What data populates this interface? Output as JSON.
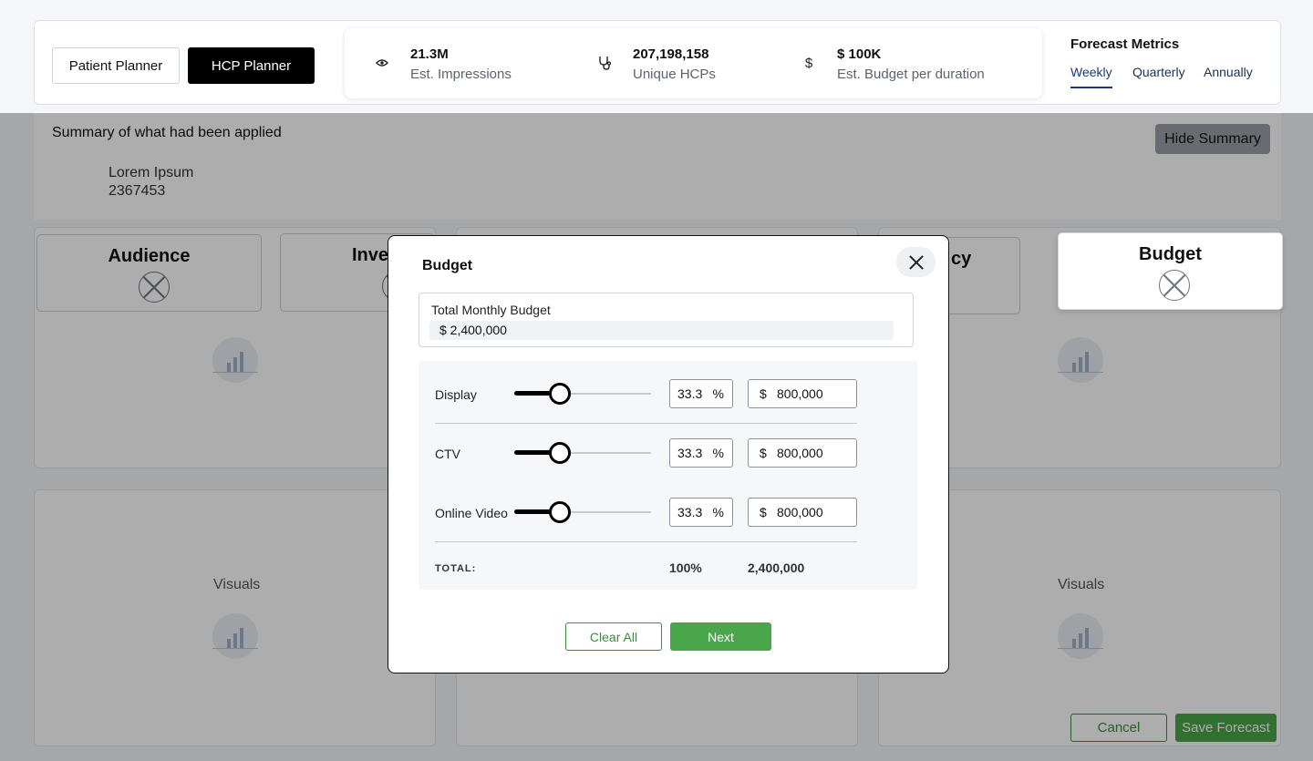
{
  "header": {
    "patient_planner": "Patient Planner",
    "hcp_planner": "HCP Planner",
    "stats": [
      {
        "icon": "eye-icon",
        "value": "21.3M",
        "label": "Est. Impressions"
      },
      {
        "icon": "stethoscope-icon",
        "value": "207,198,158",
        "label": "Unique HCPs"
      },
      {
        "icon": "dollar-icon",
        "value": "$ 100K",
        "label": "Est. Budget per duration"
      }
    ],
    "forecast_title": "Forecast Metrics",
    "tabs": [
      "Weekly",
      "Quarterly",
      "Annually"
    ],
    "active_tab": "Weekly"
  },
  "summary": {
    "title": "Summary of what had been applied",
    "hide_button": "Hide Summary",
    "line1": "Lorem Ipsum",
    "line2": "2367453"
  },
  "cards": {
    "audience": "Audience",
    "inventory_partial": "Inve",
    "frequency_partial": "cy",
    "budget": "Budget"
  },
  "visuals_label": "Visuals",
  "footer": {
    "cancel": "Cancel",
    "save": "Save Forecast"
  },
  "modal": {
    "title": "Budget",
    "total_monthly_label": "Total Monthly Budget",
    "total_monthly_value": "$ 2,400,000",
    "rows": [
      {
        "label": "Display",
        "percent": "33.3",
        "amount": "800,000",
        "slider_fraction": 0.333
      },
      {
        "label": "CTV",
        "percent": "33.3",
        "amount": "800,000",
        "slider_fraction": 0.333
      },
      {
        "label": "Online Video",
        "percent": "33.3",
        "amount": "800,000",
        "slider_fraction": 0.333
      }
    ],
    "percent_symbol": "%",
    "currency_symbol": "$",
    "total_label": "TOTAL:",
    "total_percent": "100%",
    "total_amount": "2,400,000",
    "clear_button": "Clear All",
    "next_button": "Next"
  },
  "colors": {
    "accent_green": "#4aa64a",
    "nav_blue": "#1c3b78"
  }
}
